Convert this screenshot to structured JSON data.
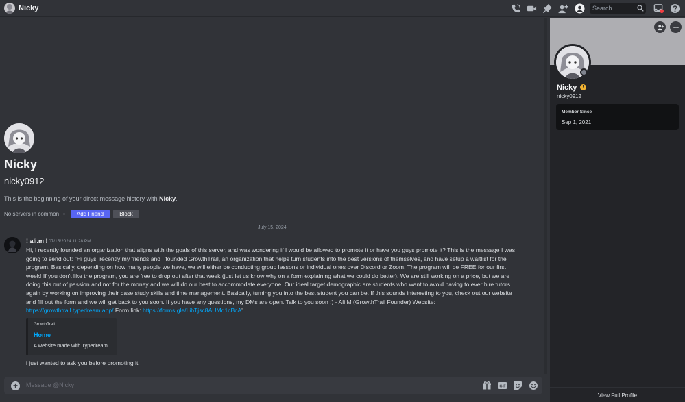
{
  "header": {
    "title": "Nicky",
    "search_placeholder": "Search",
    "icons": [
      "call-icon",
      "video-icon",
      "pin-icon",
      "add-member-icon",
      "profile-toggle-icon",
      "search-icon",
      "inbox-icon",
      "help-icon"
    ]
  },
  "intro": {
    "display_name": "Nicky",
    "username": "nicky0912",
    "beginning_text": "This is the beginning of your direct message history with ",
    "beginning_name": "Nicky",
    "beginning_end": ".",
    "servers_in_common": "No servers in common",
    "add_friend_label": "Add Friend",
    "block_label": "Block"
  },
  "divider": {
    "date": "July 15, 2024"
  },
  "message": {
    "author": "! ali.m !",
    "timestamp": "07/15/2024 11:28 PM",
    "body": "Hi, I recently founded an organization that aligns with the goals of this server, and was wondering if I would be allowed to promote it or have you guys promote it? This is the message I was going to send out: \"Hi guys, recently my friends and I founded GrowthTrail, an organization that helps turn students into the best versions of themselves, and have setup a waitlist for the program. Basically, depending on how many people we have, we will either be conducting group lessons or individual ones over Discord or Zoom. The program will be FREE for our first week! If you don't like the program, you are free to drop out after that week (just let us know why on a form explaining what we could do better). We are still working on a price, but we are doing this out of passion and not for the money and we will do our best to accommodate everyone. Our ideal target demographic are students who want to avoid having to ever hire tutors again by working on improving their base study skills and time management. Basically, turning you into the best student you can be. If this sounds interesting to you, check out our website and fill out the form and we will get back to you soon. If you have any questions, my DMs are open. Talk to you soon :) - Ali M (GrowthTrail Founder) Website: ",
    "link1": "https://growthtrail.typedream.app/",
    "between": " Form link: ",
    "link2": "https://forms.gle/LibTjsc8AUMd1cBcA",
    "tail": "\"",
    "embed": {
      "provider": "GrowthTrail",
      "title": "Home",
      "description": "A website made with Typedream."
    },
    "followup": "i just wanted to ask you before promoting it"
  },
  "composer": {
    "placeholder": "Message @Nicky",
    "icons": [
      "gift-icon",
      "gif-icon",
      "sticker-icon",
      "emoji-icon"
    ]
  },
  "profile": {
    "display_name": "Nicky",
    "username": "nicky0912",
    "member_since_label": "Member Since",
    "member_since_value": "Sep 1, 2021",
    "view_full_profile": "View Full Profile"
  },
  "colors": {
    "background": "#313338",
    "panel": "#232428",
    "accent": "#5865f2",
    "link": "#00a8fc",
    "badge": "#f0b232"
  }
}
